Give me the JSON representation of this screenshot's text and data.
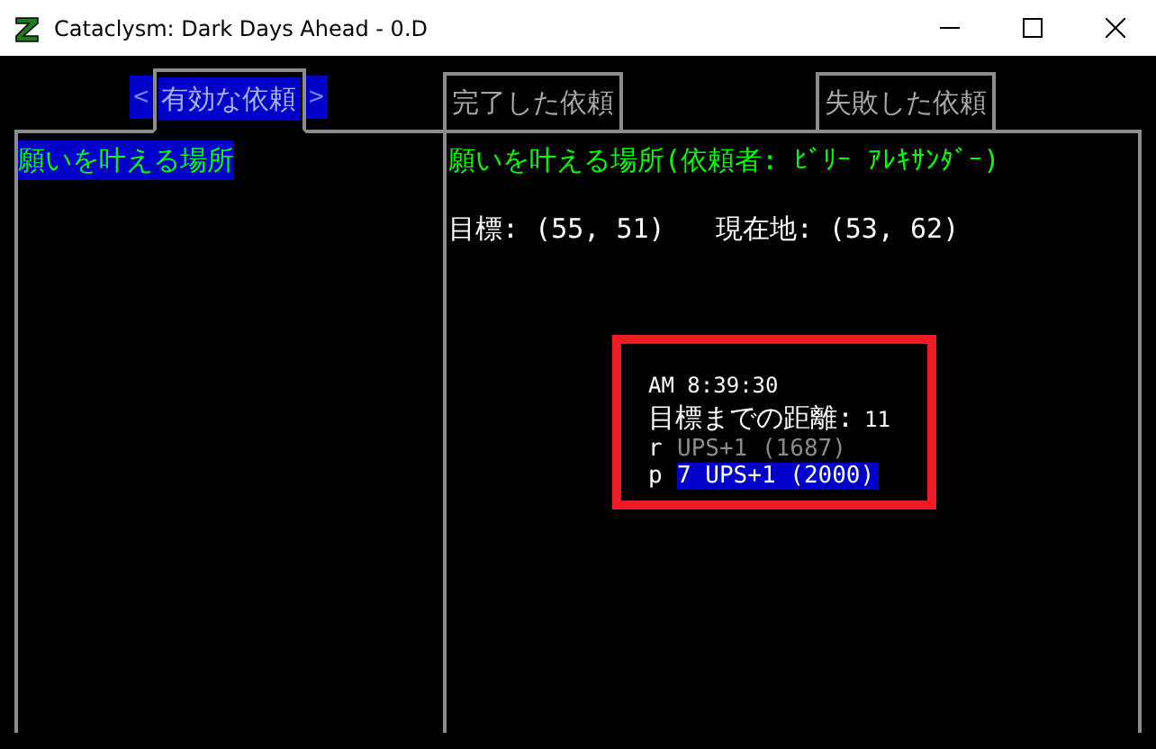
{
  "window": {
    "title": "Cataclysm: Dark Days Ahead - 0.D"
  },
  "tab_arrows": {
    "left": "<",
    "right": ">"
  },
  "tabs": [
    {
      "label": "有効な依頼",
      "selected": true
    },
    {
      "label": "完了した依頼",
      "selected": false
    },
    {
      "label": "失敗した依頼",
      "selected": false
    }
  ],
  "quests": [
    {
      "label": "願いを叶える場所",
      "selected": true
    }
  ],
  "detail": {
    "title": "願いを叶える場所(依頼者: ﾋﾞﾘｰ ｱﾚｷｻﾝﾀﾞｰ)",
    "target": "目標: (55, 51)",
    "current": "現在地: (53, 62)"
  },
  "overlay": {
    "time": "AM 8:39:30",
    "distance_label": "目標までの距離:",
    "distance": "11",
    "items": [
      {
        "key": "r",
        "label": "UPS+1 (1687)",
        "selected": false
      },
      {
        "key": "p",
        "label": "7 UPS+1 (2000)",
        "selected": true
      }
    ]
  }
}
